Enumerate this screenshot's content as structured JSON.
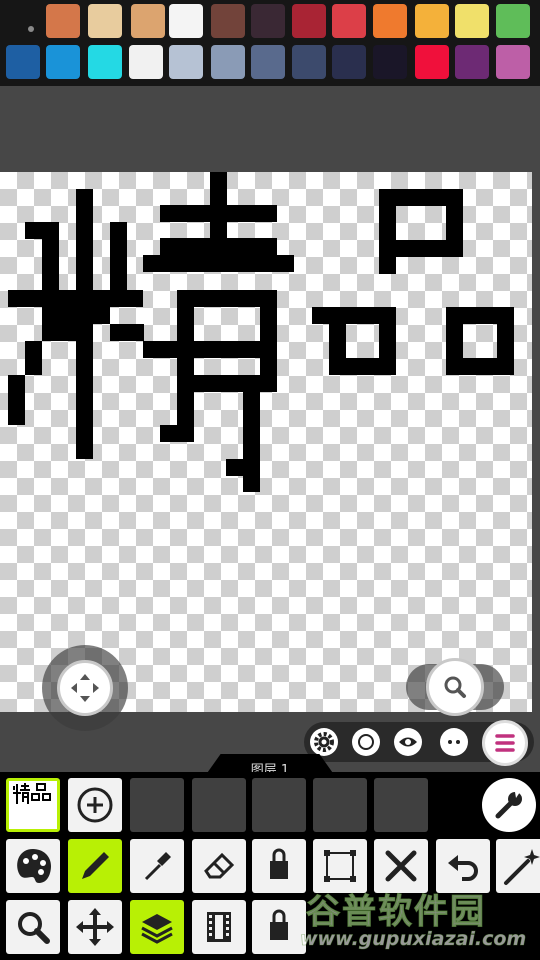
{
  "palette": {
    "row1": [
      "#d4774a",
      "#e8cc9e",
      "#dca46f",
      "#f4f4f4",
      "#72433a",
      "#3a2834",
      "#a92434",
      "#dc3f48",
      "#ef7a2e",
      "#f4b13a",
      "#f0e06a",
      "#5fbd59"
    ],
    "row2": [
      "#1e5fa3",
      "#1a93d8",
      "#24d9e4",
      "#f1f1f1",
      "#b6c2d4",
      "#8a9bb6",
      "#596a8d",
      "#3c4a6c",
      "#2a2f4e",
      "#1a1628",
      "#f0103b",
      "#6d2a74",
      "#bd5fa7"
    ]
  },
  "layer": {
    "name": "图层 1"
  },
  "watermark": {
    "title": "谷普软件园",
    "url": "www.gupuxiazai.com"
  },
  "icons": {
    "move": "move-arrows-icon",
    "zoom": "magnifier-icon",
    "settings": "gear-icon",
    "onion": "circle-icon",
    "visibility": "eye-icon",
    "more": "two-dots-icon",
    "menu": "hamburger-icon",
    "add_frame": "plus-icon",
    "tools": "wrench-icon"
  },
  "colors": {
    "accent": "#b8f005",
    "menu_accent": "#c0317e"
  }
}
